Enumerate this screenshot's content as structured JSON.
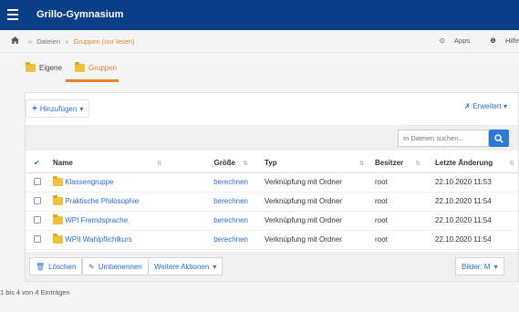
{
  "app": {
    "title": "Grillo-Gymnasium"
  },
  "breadcrumb": {
    "items": [
      "Dateien",
      "Gruppen (nur lesen)"
    ],
    "separator": "»"
  },
  "toplinks": {
    "apps": "Apps",
    "help": "Hilfe"
  },
  "tabs": [
    {
      "label": "Eigene",
      "active": false
    },
    {
      "label": "Gruppen",
      "active": true
    }
  ],
  "toolbar": {
    "add_label": "Hinzufügen",
    "advanced_label": "Erweitert"
  },
  "search": {
    "placeholder": "In Dateien suchen..."
  },
  "table": {
    "columns": [
      "Name",
      "Größe",
      "Typ",
      "Besitzer",
      "Letzte Änderung"
    ],
    "rows": [
      {
        "name": "Klassengruppe",
        "size": "berechnen",
        "type": "Verknüpfung mit Ordner",
        "owner": "root",
        "modified": "22.10.2020 11:53"
      },
      {
        "name": "Praktische Philosophie",
        "size": "berechnen",
        "type": "Verknüpfung mit Ordner",
        "owner": "root",
        "modified": "22.10.2020 11:54"
      },
      {
        "name": "WPI Fremdsprache",
        "size": "berechnen",
        "type": "Verknüpfung mit Ordner",
        "owner": "root",
        "modified": "22.10.2020 11:54"
      },
      {
        "name": "WPII Wahlpflichtkurs",
        "size": "berechnen",
        "type": "Verknüpfung mit Ordner",
        "owner": "root",
        "modified": "22.10.2020 11:54"
      }
    ]
  },
  "actions": {
    "delete": "Löschen",
    "rename": "Umbenennen",
    "more": "Weitere Aktionen",
    "images": "Bilder: M"
  },
  "footer": {
    "count_text": "1 bis 4 von 4 Einträgen"
  },
  "colors": {
    "header": "#0a3e86",
    "accent": "#e8832a",
    "link": "#2a6fc9"
  }
}
